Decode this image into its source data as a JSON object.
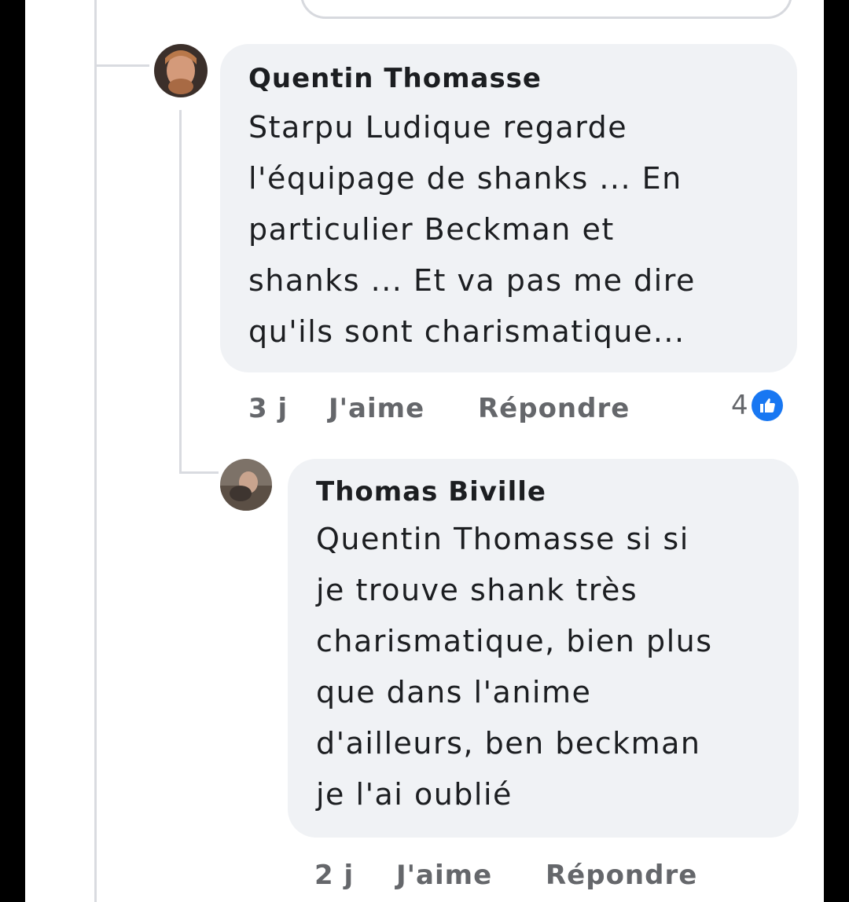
{
  "comments": [
    {
      "author": "Quentin Thomasse",
      "text": "Starpu Ludique regarde\nl'équipage de shanks ... En\nparticulier Beckman et\nshanks ... Et va pas me dire\nqu'ils sont charismatique...",
      "time": "3 j",
      "like_label": "J'aime",
      "reply_label": "Répondre",
      "reaction_count": "4",
      "reaction_icon": "like-icon"
    },
    {
      "author": "Thomas Biville",
      "text": "Quentin Thomasse si si\nje trouve shank très\ncharismatique, bien plus\nque dans l'anime\nd'ailleurs, ben beckman\nje l'ai oublié",
      "time": "2 j",
      "like_label": "J'aime",
      "reply_label": "Répondre"
    }
  ],
  "colors": {
    "bubble": "#f0f2f5",
    "meta_text": "#65676b",
    "like_blue": "#1877f2"
  }
}
